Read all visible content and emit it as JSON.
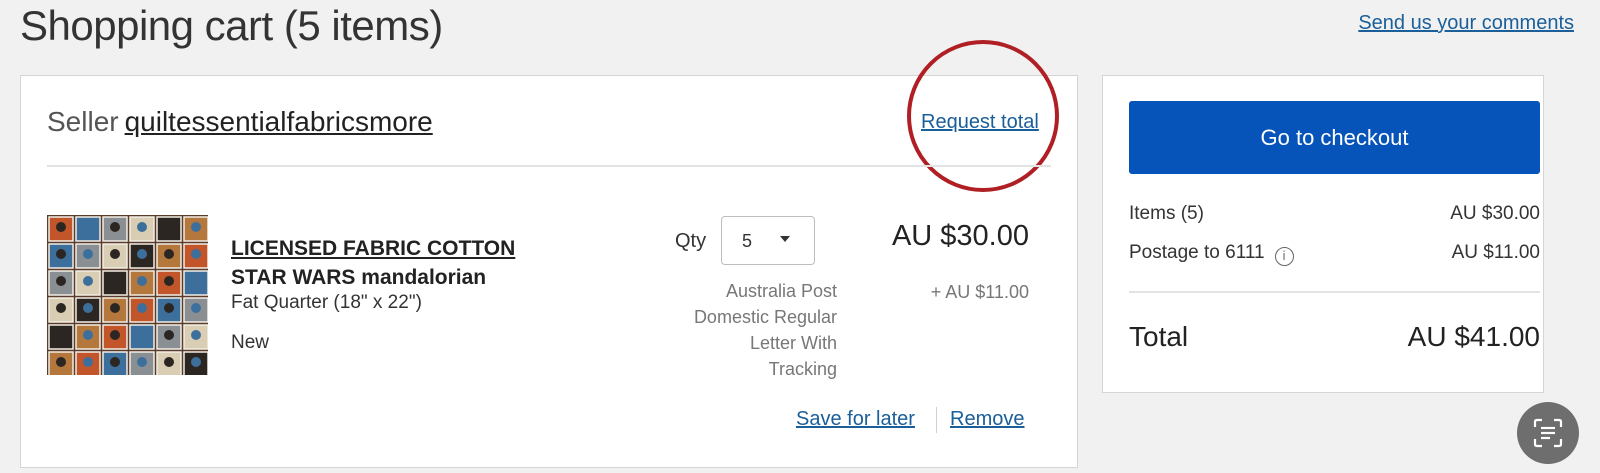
{
  "header": {
    "title": "Shopping cart (5 items)",
    "feedback_link": "Send us your comments"
  },
  "seller": {
    "prefix": "Seller",
    "name": "quiltessentialfabricsmore",
    "request_total": "Request total"
  },
  "item": {
    "title_line1": "LICENSED FABRIC COTTON",
    "title_line2": "STAR WARS mandalorian",
    "variant": "Fat Quarter (18\" x 22\")",
    "condition": "New",
    "qty_label": "Qty",
    "qty_value": "5",
    "price": "AU $30.00",
    "postage_price": "+ AU $11.00",
    "shipping_method_lines": [
      "Australia Post",
      "Domestic Regular",
      "Letter With",
      "Tracking"
    ],
    "save_for_later": "Save for later",
    "remove": "Remove"
  },
  "summary": {
    "checkout_button": "Go to checkout",
    "items_label": "Items (5)",
    "items_value": "AU $30.00",
    "postage_label": "Postage to 6111",
    "postage_value": "AU $11.00",
    "info_icon_glyph": "i",
    "total_label": "Total",
    "total_value": "AU $41.00"
  },
  "colors": {
    "accent": "#0654ba",
    "link": "#1a5e9a",
    "annotation": "#b01f24"
  },
  "icons": {
    "info": "info-icon",
    "chevron": "chevron-down-icon",
    "scan": "scan-text-icon"
  }
}
